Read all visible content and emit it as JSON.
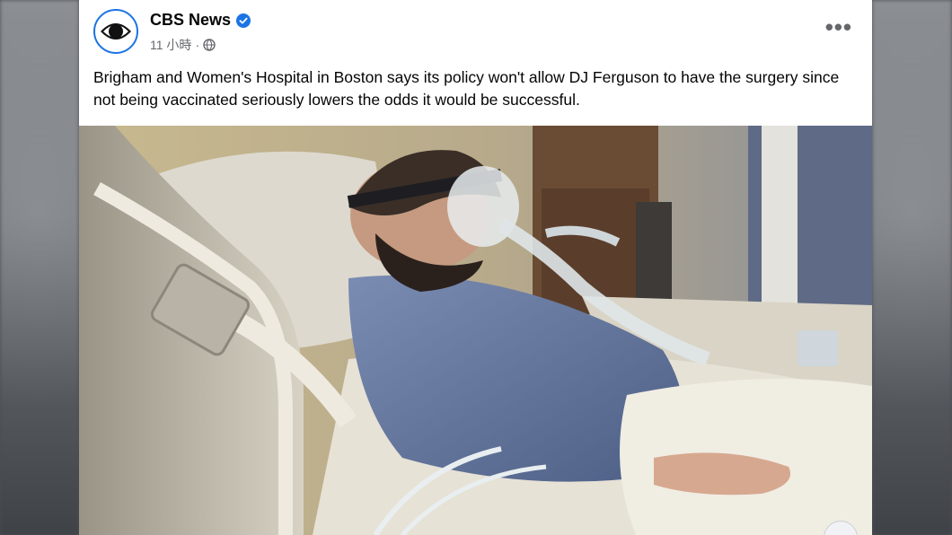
{
  "post": {
    "page_name": "CBS News",
    "timestamp": "11 小時",
    "separator": "·",
    "caption": "Brigham and Women's Hospital in Boston says its policy won't allow DJ Ferguson to have the surgery since not being vaccinated seriously lowers the odds it would be successful.",
    "more_label": "•••",
    "icons": {
      "avatar": "cbs-eye-logo",
      "verified": "verified-badge-icon",
      "privacy": "globe-icon",
      "more": "more-options-icon"
    },
    "photo": {
      "subject": "patient-in-hospital-bed-photo"
    }
  },
  "colors": {
    "accent": "#1b74e4",
    "text_primary": "#050505",
    "text_secondary": "#65676b",
    "card_bg": "#ffffff"
  }
}
